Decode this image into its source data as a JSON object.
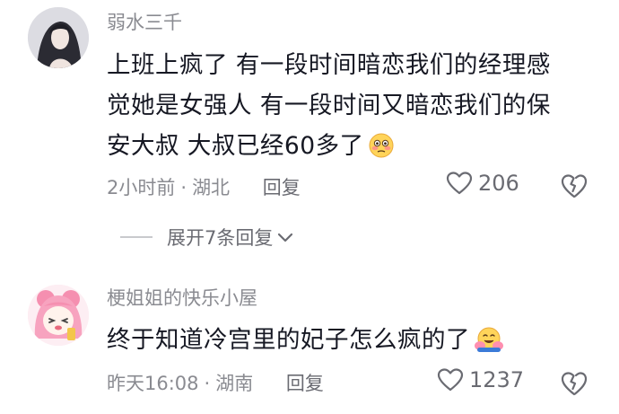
{
  "comments": [
    {
      "username": "弱水三千",
      "text_lines": [
        "上班上疯了 有一段时间暗恋我们的经理感",
        "觉她是女强人 有一段时间又暗恋我们的保",
        "安大叔 大叔已经60多了"
      ],
      "emoji": "flushed-face-emoji",
      "time": "2小时前",
      "separator": "·",
      "location": "湖北",
      "reply_label": "回复",
      "like_count": "206",
      "expand_label": "展开7条回复"
    },
    {
      "username": "梗姐姐的快乐小屋",
      "text_lines": [
        "终于知道冷宫里的妃子怎么疯的了"
      ],
      "emoji": "hugging-face-emoji",
      "time": "昨天16:08",
      "separator": "·",
      "location": "湖南",
      "reply_label": "回复",
      "like_count": "1237"
    }
  ],
  "icons": {
    "like": "heart-outline-icon",
    "dislike": "broken-heart-icon",
    "expand": "chevron-down-icon"
  },
  "colors": {
    "text": "#161823",
    "secondary": "#8a8b91",
    "action": "#6a6b72"
  }
}
